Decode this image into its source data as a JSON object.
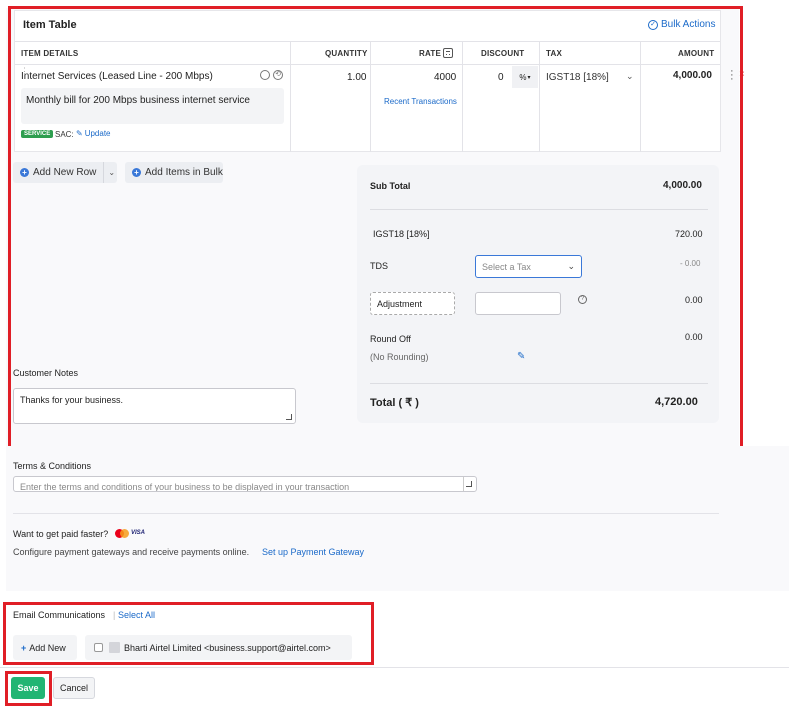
{
  "item_table": {
    "title": "Item Table",
    "bulk_actions": "Bulk Actions",
    "columns": {
      "item_details": "ITEM DETAILS",
      "quantity": "QUANTITY",
      "rate": "RATE",
      "discount": "DISCOUNT",
      "tax": "TAX",
      "amount": "AMOUNT"
    },
    "row": {
      "name": "Internet Services (Leased Line - 200 Mbps)",
      "description": "Monthly bill for 200 Mbps business internet service",
      "badge": "SERVICE",
      "sac": "SAC:",
      "update": "Update",
      "quantity": "1.00",
      "rate": "4000",
      "recent_transactions": "Recent Transactions",
      "discount": "0",
      "discount_unit": "%",
      "tax": "IGST18 [18%]",
      "amount": "4,000.00"
    },
    "add_new_row": "Add New Row",
    "add_items_bulk": "Add Items in Bulk"
  },
  "summary": {
    "sub_total_label": "Sub Total",
    "sub_total_value": "4,000.00",
    "igst_label": "IGST18 [18%]",
    "igst_value": "720.00",
    "tds_label": "TDS",
    "tds_placeholder": "Select a Tax",
    "tds_value": "- 0.00",
    "adjustment_label": "Adjustment",
    "adjustment_value": "0.00",
    "round_off_label": "Round Off",
    "round_off_note": "(No Rounding)",
    "round_off_value": "0.00",
    "total_label": "Total ( ₹ )",
    "total_value": "4,720.00"
  },
  "customer_notes": {
    "label": "Customer Notes",
    "value": "Thanks for your business."
  },
  "terms": {
    "label": "Terms & Conditions",
    "placeholder": "Enter the terms and conditions of your business to be displayed in your transaction"
  },
  "payment": {
    "title": "Want to get paid faster?",
    "visa": "VISA",
    "text": "Configure payment gateways and receive payments online.",
    "link": "Set up Payment Gateway"
  },
  "email": {
    "label": "Email Communications",
    "select_all": "Select All",
    "add_new": "Add New",
    "contact": "Bharti Airtel Limited <business.support@airtel.com>"
  },
  "footer": {
    "save": "Save",
    "cancel": "Cancel"
  },
  "colors": {
    "accent": "#1b6ac9",
    "save_green": "#22b573",
    "highlight_red": "#e01e26",
    "service_badge": "#2e9e4f"
  }
}
